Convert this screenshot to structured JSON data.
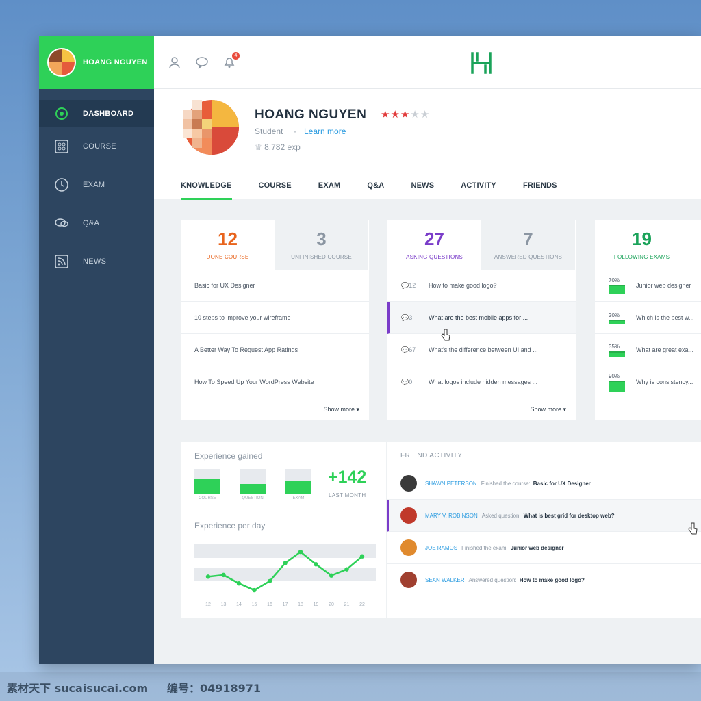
{
  "sidebar": {
    "user_name": "HOANG NGUYEN",
    "items": [
      {
        "label": "DASHBOARD",
        "icon": "dashboard-icon"
      },
      {
        "label": "COURSE",
        "icon": "grid-icon"
      },
      {
        "label": "EXAM",
        "icon": "clock-icon"
      },
      {
        "label": "Q&A",
        "icon": "chat-icon"
      },
      {
        "label": "NEWS",
        "icon": "rss-icon"
      }
    ]
  },
  "topbar": {
    "icons": [
      "user-icon",
      "chat-icon",
      "notification-icon"
    ],
    "notification_count": "4",
    "logo": "H"
  },
  "profile": {
    "name": "HOANG NGUYEN",
    "rating": 3,
    "rating_max": 5,
    "role": "Student",
    "separator": "·",
    "learn_more": "Learn more",
    "exp": "8,782 exp"
  },
  "tabs": [
    "KNOWLEDGE",
    "COURSE",
    "EXAM",
    "Q&A",
    "NEWS",
    "ACTIVITY",
    "FRIENDS"
  ],
  "course_card": {
    "active": {
      "value": "12",
      "label": "DONE COURSE"
    },
    "inactive": {
      "value": "3",
      "label": "UNFINISHED COURSE"
    },
    "rows": [
      "Basic for UX Designer",
      "10 steps to improve your wireframe",
      "A Better Way To Request App Ratings",
      "How To Speed Up Your WordPress Website"
    ],
    "show_more": "Show more ▾"
  },
  "question_card": {
    "active": {
      "value": "27",
      "label": "ASKING QUESTIONS"
    },
    "inactive": {
      "value": "7",
      "label": "ANSWERED QUESTIONS"
    },
    "rows": [
      {
        "count": "12",
        "text": "How to make good logo?"
      },
      {
        "count": "3",
        "text": "What are the best mobile apps for ..."
      },
      {
        "count": "67",
        "text": "What's the difference between UI and ..."
      },
      {
        "count": "0",
        "text": "What logos include hidden messages ..."
      }
    ],
    "show_more": "Show more ▾"
  },
  "exam_card": {
    "active": {
      "value": "19",
      "label": "FOLLOWING EXAMS"
    },
    "rows": [
      {
        "pct": "70%",
        "level": 0.7,
        "text": "Junior web designer"
      },
      {
        "pct": "20%",
        "level": 0.2,
        "text": "Which is the best w..."
      },
      {
        "pct": "35%",
        "level": 0.35,
        "text": "What are great exa..."
      },
      {
        "pct": "90%",
        "level": 0.9,
        "text": "Why is consistency..."
      }
    ]
  },
  "experience": {
    "title": "Experience gained",
    "bars": [
      {
        "label": "COURSE",
        "level": 0.6
      },
      {
        "label": "QUESTION",
        "level": 0.4
      },
      {
        "label": "EXAM",
        "level": 0.5
      }
    ],
    "total": "+142",
    "total_label": "LAST MONTH",
    "per_day_title": "Experience per day"
  },
  "chart_data": {
    "type": "line",
    "x": [
      "12",
      "13",
      "14",
      "15",
      "16",
      "17",
      "18",
      "19",
      "20",
      "21",
      "22"
    ],
    "series": [
      {
        "values": [
          3.0,
          3.3,
          1.8,
          0.6,
          2.2,
          5.4,
          7.4,
          5.2,
          3.2,
          4.3,
          6.6
        ]
      }
    ],
    "ylim": [
      0,
      9
    ],
    "grid": true,
    "color": "#2ed158"
  },
  "friend_activity": {
    "title": "FRIEND ACTIVITY",
    "rows": [
      {
        "name": "SHAWN PETERSON",
        "action": "Finished the course:",
        "object": "Basic for UX Designer",
        "color": "#3a3a3a"
      },
      {
        "name": "MARY V. ROBINSON",
        "action": "Asked question:",
        "object": "What is best grid for desktop web?",
        "color": "#c0392b"
      },
      {
        "name": "JOE RAMOS",
        "action": "Finished the exam:",
        "object": "Junior web designer",
        "color": "#e08a2e"
      },
      {
        "name": "SEAN WALKER",
        "action": "Answered question:",
        "object": "How to make good logo?",
        "color": "#a04030"
      }
    ]
  },
  "watermark": {
    "left": "素材天下 sucaisucai.com",
    "right": "编号：04918971"
  },
  "colors": {
    "accent": "#2ed158",
    "sidebar": "#2d4560",
    "orange": "#e8641d",
    "purple": "#7a3cc9",
    "teal": "#1ba35a"
  }
}
